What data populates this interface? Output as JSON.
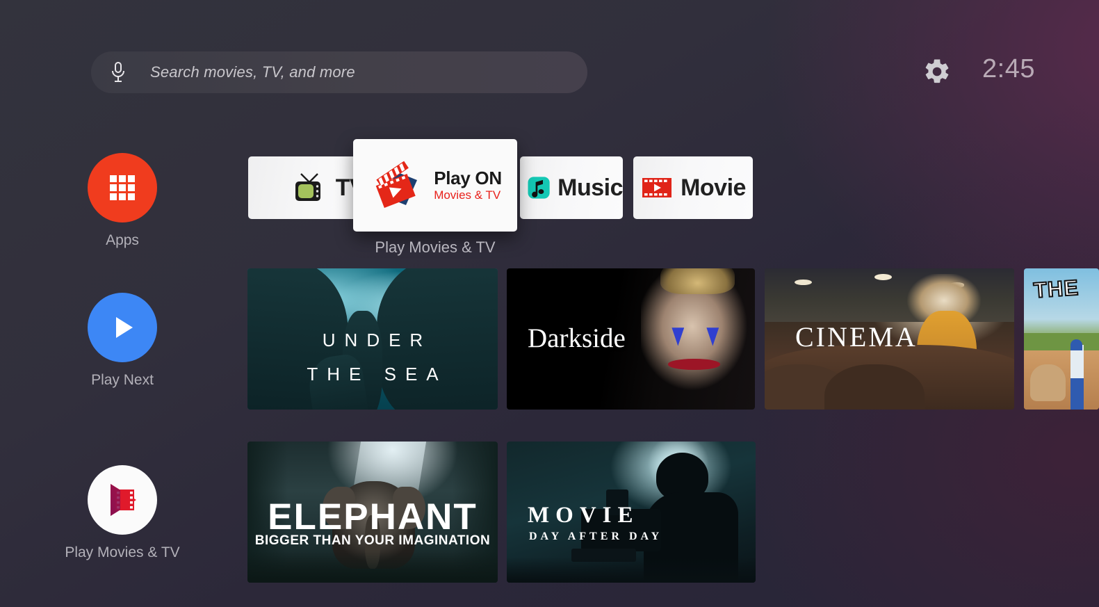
{
  "colors": {
    "bg_left": "#33333d",
    "bg_right": "#5a2a4c",
    "accent_red": "#e8211b",
    "apps_red": "#f03c1e",
    "play_next_blue": "#3d87f5",
    "music_teal": "#14c8b4"
  },
  "search": {
    "placeholder": "Search movies, TV, and more",
    "mic_icon": "microphone-icon"
  },
  "status": {
    "settings_icon": "gear-icon",
    "time": "2:45"
  },
  "sidebar": {
    "items": [
      {
        "label": "Apps",
        "icon": "apps-grid-icon"
      },
      {
        "label": "Play Next",
        "icon": "play-triangle-icon"
      },
      {
        "label": "Play Movies & TV",
        "icon": "play-movies-tv-icon"
      }
    ]
  },
  "app_row": {
    "focused_caption": "Play Movies & TV",
    "focused_card": {
      "title": "Play ON",
      "subtitle": "Movies & TV",
      "icon": "clapperboard-play-icon"
    },
    "cards": [
      {
        "label": "TV",
        "icon": "retro-tv-icon"
      },
      {
        "label": "Music",
        "icon": "music-note-icon"
      },
      {
        "label": "Movie",
        "icon": "film-strip-play-icon"
      }
    ]
  },
  "content_rows": [
    {
      "tiles": [
        {
          "title": "UNDER",
          "title2": "THE SEA",
          "art": "underwater-cave"
        },
        {
          "title": "Darkside",
          "art": "joker-face-portrait"
        },
        {
          "title": "CINEMA",
          "art": "theater-seats-woman"
        },
        {
          "title": "THE",
          "art": "boy-and-dog-baseball-field"
        }
      ]
    },
    {
      "tiles": [
        {
          "title": "ELEPHANT",
          "subtitle": "BIGGER THAN YOUR IMAGINATION",
          "art": "elephant-in-forest"
        },
        {
          "title": "MOVIE",
          "subtitle": "DAY AFTER DAY",
          "art": "cameraman-silhouette"
        }
      ]
    }
  ]
}
